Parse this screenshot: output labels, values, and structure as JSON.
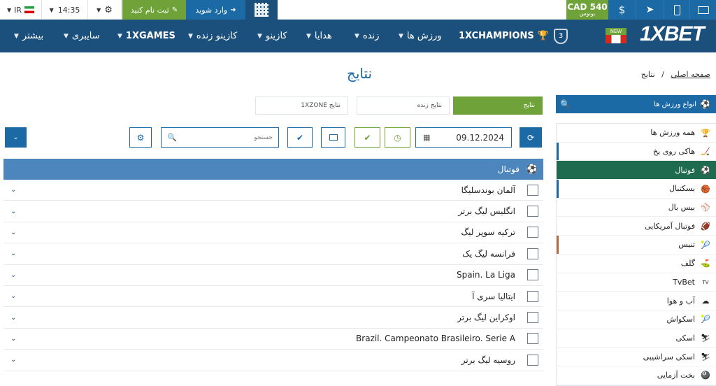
{
  "topbar": {
    "lang": "IR",
    "time": "14:35",
    "register": "ثبت نام کنید",
    "login": "وارد شوید",
    "bonus_amount": "CAD 540",
    "bonus_label": "بونوس"
  },
  "nav": {
    "logo": "1XBET",
    "new_badge": "NEW",
    "items": [
      "1XCHAMPIONS",
      "ورزش ها",
      "زنده",
      "هدایا",
      "کازینو",
      "کازینو زنده",
      "1XGAMES",
      "سایبری",
      "بیشتر"
    ]
  },
  "breadcrumb": {
    "home": "صفحه اصلی",
    "sep": "/",
    "current": "نتایج"
  },
  "page_title": "نتایج",
  "tabs": {
    "results": "نتایج",
    "live_results": "نتایج زنده",
    "xzone_results": "1XZONE نتایج"
  },
  "controls": {
    "date": "09.12.2024",
    "search_placeholder": "جستجو"
  },
  "sidebar": {
    "header": "انواع ورزش ها",
    "items": [
      "همه ورزش ها",
      "هاکی روی یخ",
      "فوتبال",
      "بسکتبال",
      "بیس بال",
      "فوتبال آمریکایی",
      "تنیس",
      "گلف",
      "TvBet",
      "آب و هوا",
      "اسکواش",
      "اسکی",
      "اسکی سراشیبی",
      "بخت آزمایی"
    ]
  },
  "panel": {
    "title": "فوتبال",
    "leagues": [
      "آلمان بوندسلیگا",
      "انگلیس لیگ برتر",
      "ترکیه سوپر لیگ",
      "فرانسه لیگ یک",
      "Spain. La Liga",
      "ایتالیا سری آ",
      "اوکراین لیگ برتر",
      "Brazil. Campeonato Brasileiro. Serie A",
      "روسیه لیگ برتر"
    ]
  },
  "colors": {
    "nav_bg": "#1b4f7c",
    "accent": "#1b6aa5",
    "green": "#6fa33a",
    "active_sport": "#1f6b4f"
  }
}
